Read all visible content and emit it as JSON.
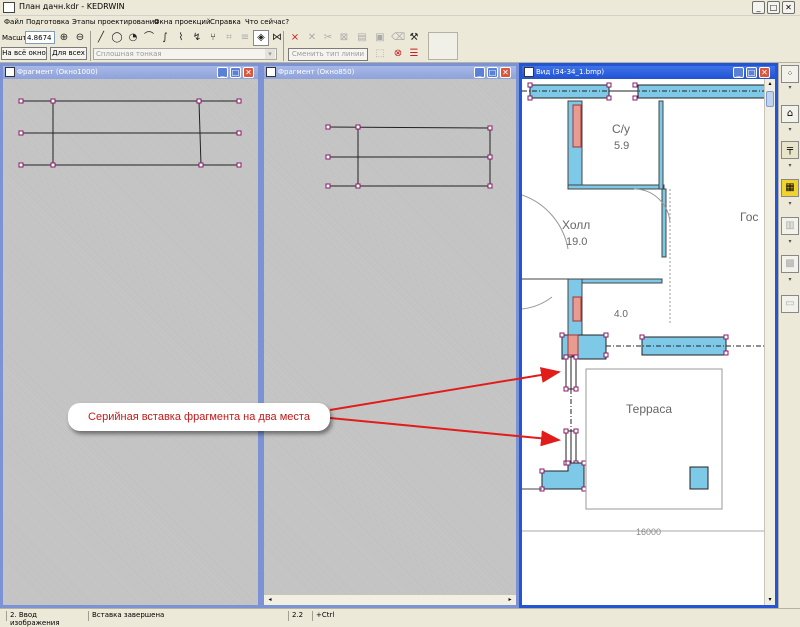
{
  "app": {
    "title": "План дачн.kdr - KEDRWIN",
    "window_min": "_",
    "window_max": "□",
    "window_close": "✕"
  },
  "menu": [
    "Файл",
    "Подготовка",
    "Этапы проектирования",
    "Окна проекций",
    "Справка",
    "Что сейчас?"
  ],
  "toolbar": {
    "scale_label": "Масшт",
    "scale_value": "4.8674",
    "fit_window_label": "На всё окно",
    "fit_all_label": "Для всех",
    "line_style_placeholder": "Сплошная тонкая",
    "snap_button_label": "Сменить тип линии"
  },
  "windows": [
    {
      "title": "Фрагмент (Окно1000)"
    },
    {
      "title": "Фрагмент (Окно850)"
    },
    {
      "title": "Вид (34-34_1.bmp)"
    }
  ],
  "plan_labels": {
    "su": "С/у",
    "su_area": "5.9",
    "hall": "Холл",
    "hall_area": "19.0",
    "gost": "Гос",
    "small_area": "4.0",
    "terrace": "Терраса",
    "dimension": "16000"
  },
  "callout": {
    "text": "Серийная вставка фрагмента на два места",
    "color": "#d01818"
  },
  "status": {
    "mode": "2. Ввод изображения",
    "message": "Вставка завершена",
    "coord": "2.2",
    "modifier": "+Ctrl"
  }
}
